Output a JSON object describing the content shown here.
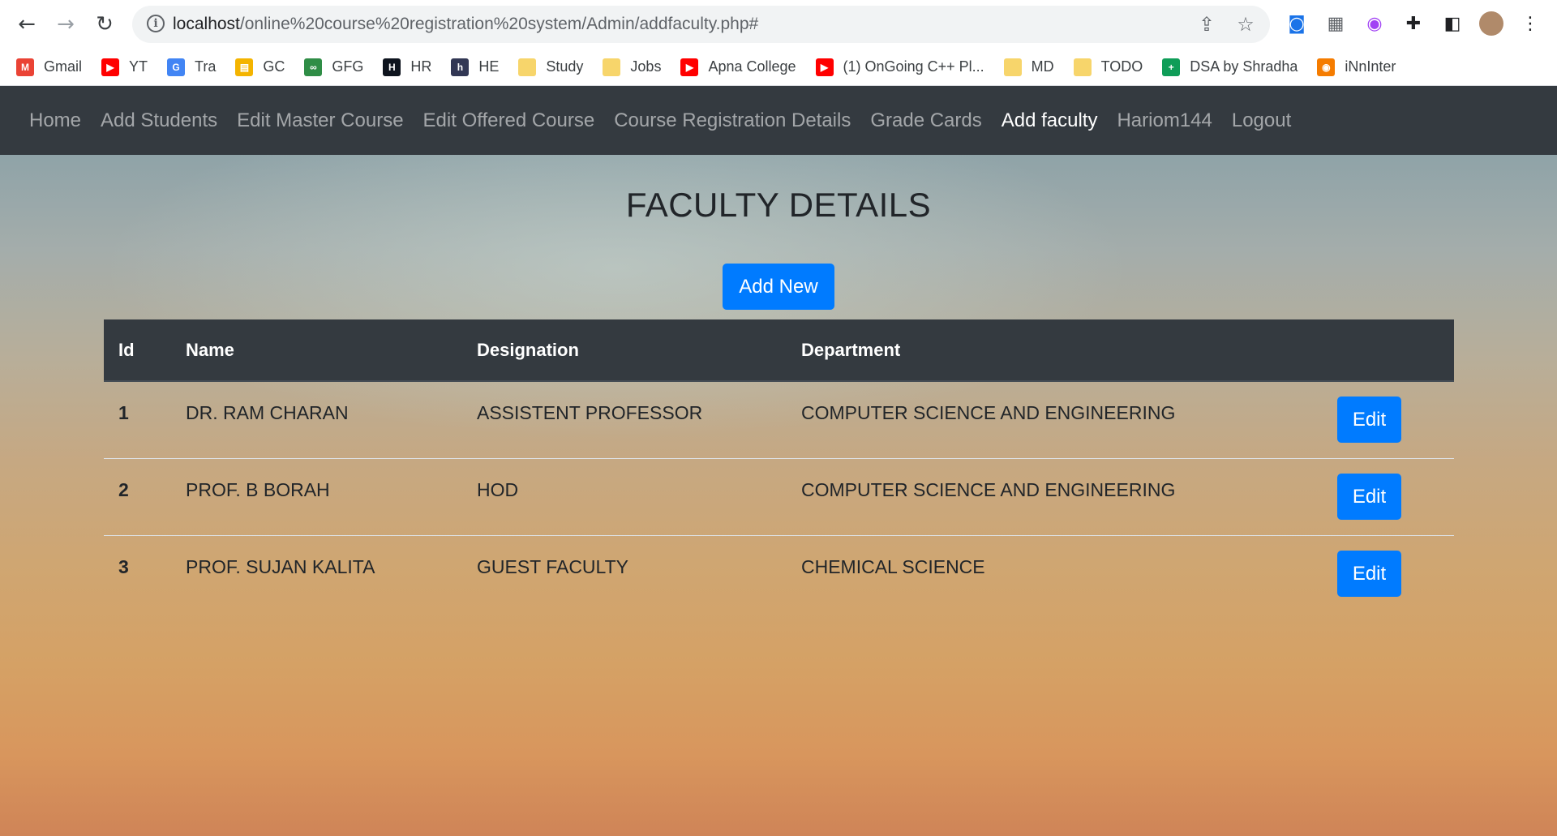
{
  "browser": {
    "url_host": "localhost",
    "url_path": "/online%20course%20registration%20system/Admin/addfaculty.php#",
    "bookmarks": [
      {
        "label": "Gmail",
        "icon": "gmail-icon",
        "color": "#ea4335",
        "glyph": "M"
      },
      {
        "label": "YT",
        "icon": "youtube-icon",
        "color": "#ff0000",
        "glyph": "▶"
      },
      {
        "label": "Tra",
        "icon": "translate-icon",
        "color": "#4285f4",
        "glyph": "G"
      },
      {
        "label": "GC",
        "icon": "classroom-icon",
        "color": "#f4b400",
        "glyph": "▤"
      },
      {
        "label": "GFG",
        "icon": "gfg-icon",
        "color": "#2f8d46",
        "glyph": "∞"
      },
      {
        "label": "HR",
        "icon": "hackerrank-icon",
        "color": "#0e141e",
        "glyph": "H"
      },
      {
        "label": "HE",
        "icon": "hackerearth-icon",
        "color": "#323754",
        "glyph": "h"
      },
      {
        "label": "Study",
        "icon": "folder-icon",
        "color": "#f7d56b",
        "glyph": ""
      },
      {
        "label": "Jobs",
        "icon": "folder-icon",
        "color": "#f7d56b",
        "glyph": ""
      },
      {
        "label": "Apna College",
        "icon": "youtube-icon",
        "color": "#ff0000",
        "glyph": "▶"
      },
      {
        "label": "(1) OnGoing C++ Pl...",
        "icon": "youtube-icon",
        "color": "#ff0000",
        "glyph": "▶"
      },
      {
        "label": "MD",
        "icon": "folder-icon",
        "color": "#f7d56b",
        "glyph": ""
      },
      {
        "label": "TODO",
        "icon": "folder-icon",
        "color": "#f7d56b",
        "glyph": ""
      },
      {
        "label": "DSA by Shradha",
        "icon": "sheets-icon",
        "color": "#0f9d58",
        "glyph": "+"
      },
      {
        "label": "iNnInter",
        "icon": "globe-icon",
        "color": "#f57c00",
        "glyph": "◉"
      }
    ]
  },
  "nav": {
    "links": [
      {
        "label": "Home"
      },
      {
        "label": "Add Students"
      },
      {
        "label": "Edit Master Course"
      },
      {
        "label": "Edit Offered Course"
      },
      {
        "label": "Course Registration Details"
      },
      {
        "label": "Grade Cards"
      },
      {
        "label": "Add faculty"
      },
      {
        "label": "Hariom144"
      },
      {
        "label": "Logout"
      }
    ],
    "active": "Add faculty"
  },
  "page": {
    "title": "FACULTY DETAILS",
    "add_button": "Add New"
  },
  "table": {
    "headers": [
      "Id",
      "Name",
      "Designation",
      "Department"
    ],
    "rows": [
      {
        "id": "1",
        "name": "DR. RAM CHARAN",
        "designation": "ASSISTENT PROFESSOR",
        "department": "COMPUTER SCIENCE AND ENGINEERING",
        "action": "Edit"
      },
      {
        "id": "2",
        "name": "PROF. B BORAH",
        "designation": "HOD",
        "department": "COMPUTER SCIENCE AND ENGINEERING",
        "action": "Edit"
      },
      {
        "id": "3",
        "name": "PROF. SUJAN KALITA",
        "designation": "GUEST FACULTY",
        "department": "CHEMICAL SCIENCE",
        "action": "Edit"
      }
    ]
  },
  "colors": {
    "navbar": "#343a40",
    "primary": "#007bff"
  }
}
